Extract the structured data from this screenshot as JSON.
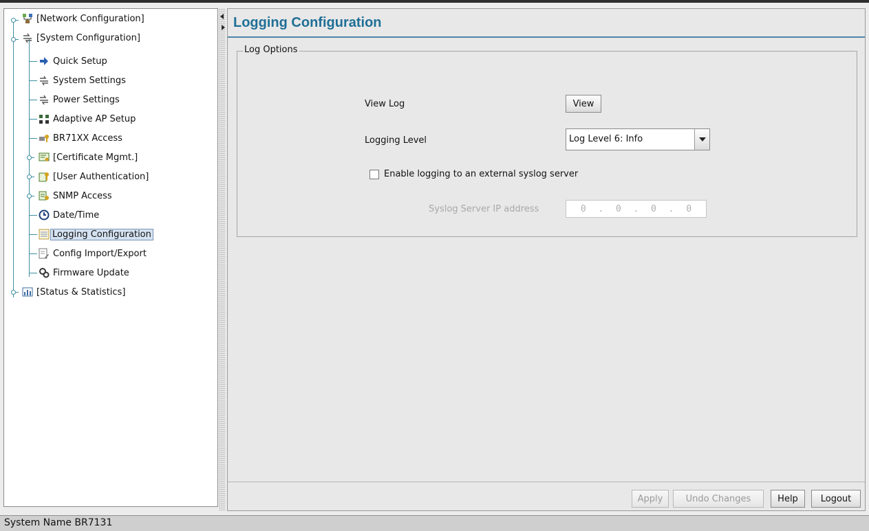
{
  "tree": {
    "items": [
      {
        "label": "[Network Configuration]",
        "icon": "network-config-icon"
      },
      {
        "label": "[System Configuration]",
        "icon": "system-config-icon"
      },
      {
        "label": "Quick Setup",
        "icon": "arrow-right-icon"
      },
      {
        "label": "System Settings",
        "icon": "system-settings-icon"
      },
      {
        "label": "Power Settings",
        "icon": "power-settings-icon"
      },
      {
        "label": "Adaptive AP Setup",
        "icon": "adaptive-ap-icon"
      },
      {
        "label": "BR71XX Access",
        "icon": "access-key-icon"
      },
      {
        "label": "[Certificate Mgmt.]",
        "icon": "certificate-icon"
      },
      {
        "label": "[User Authentication]",
        "icon": "user-auth-icon"
      },
      {
        "label": "SNMP Access",
        "icon": "snmp-icon"
      },
      {
        "label": "Date/Time",
        "icon": "clock-icon"
      },
      {
        "label": "Logging Configuration",
        "icon": "log-list-icon"
      },
      {
        "label": "Config Import/Export",
        "icon": "import-export-icon"
      },
      {
        "label": "Firmware Update",
        "icon": "firmware-gears-icon"
      },
      {
        "label": "[Status & Statistics]",
        "icon": "bar-chart-icon"
      }
    ],
    "selected": "Logging Configuration"
  },
  "main": {
    "title": "Logging Configuration",
    "group_label": "Log Options",
    "view_log_label": "View Log",
    "view_button": "View",
    "logging_level_label": "Logging Level",
    "logging_level_value": "Log Level 6: Info",
    "external_syslog_label": "Enable logging to an external syslog server",
    "external_syslog_checked": false,
    "syslog_ip_label": "Syslog Server IP address",
    "syslog_ip_octets": [
      "0",
      "0",
      "0",
      "0"
    ]
  },
  "footer": {
    "apply": "Apply",
    "undo": "Undo Changes",
    "help": "Help",
    "logout": "Logout"
  },
  "status": {
    "system_name": "System Name BR7131"
  },
  "colors": {
    "title": "#1f6f96",
    "tree_line": "#3c8fa0",
    "selection_bg": "#d5e2f1"
  }
}
